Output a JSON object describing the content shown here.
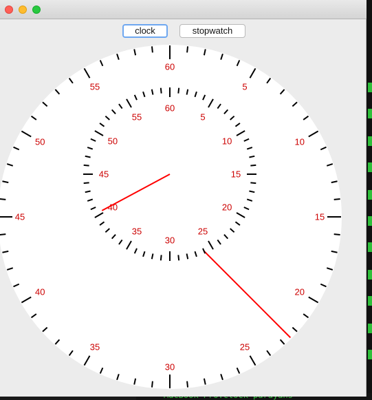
{
  "tabs": [
    {
      "label": "clock",
      "selected": true
    },
    {
      "label": "stopwatch",
      "selected": false
    }
  ],
  "terminal": {
    "text": "MacBook-Pro:clock parayans"
  },
  "colors": {
    "number_color": "#cc0000",
    "hand_color": "#ff0000",
    "face_color": "#ffffff",
    "tick_color": "#000000",
    "window_bg": "#ececec"
  },
  "outer_dial": {
    "labels": [
      "60",
      "5",
      "10",
      "15",
      "20",
      "25",
      "30",
      "35",
      "40",
      "45",
      "50",
      "55"
    ]
  },
  "inner_dial": {
    "labels": [
      "60",
      "5",
      "10",
      "15",
      "20",
      "25",
      "30",
      "35",
      "40",
      "45",
      "50",
      "55"
    ]
  },
  "hands": {
    "outer_hand_value": 22.5,
    "inner_hand_value": 40.3
  }
}
